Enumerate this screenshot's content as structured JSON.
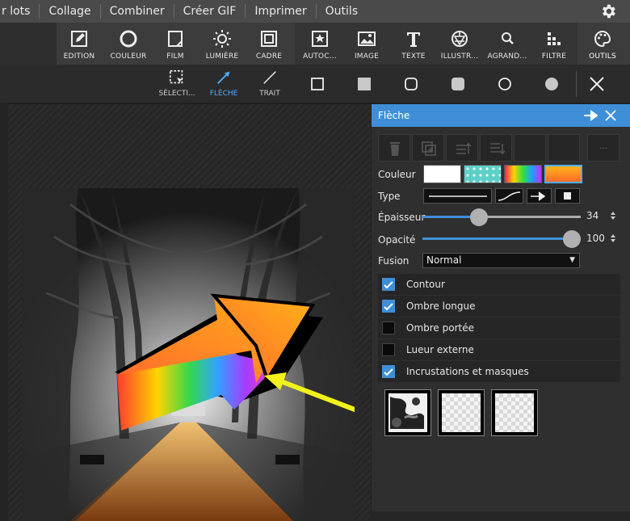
{
  "menu": [
    "r lots",
    "Collage",
    "Combiner",
    "Créer GIF",
    "Imprimer",
    "Outils"
  ],
  "toolbar": [
    {
      "label": "EDITION",
      "icon": "edit-icon"
    },
    {
      "label": "COULEUR",
      "icon": "color-icon"
    },
    {
      "label": "FILM",
      "icon": "film-icon"
    },
    {
      "label": "LUMIÈRE",
      "icon": "light-icon"
    },
    {
      "label": "CADRE",
      "icon": "frame-icon"
    },
    {
      "label": "AUTOC...",
      "icon": "sticker-icon"
    },
    {
      "label": "IMAGE",
      "icon": "image-icon"
    },
    {
      "label": "TEXTE",
      "icon": "text-icon"
    },
    {
      "label": "ILLUSTR...",
      "icon": "illustration-icon"
    },
    {
      "label": "AGRAND...",
      "icon": "zoom-icon"
    },
    {
      "label": "FILTRE",
      "icon": "filter-icon"
    },
    {
      "label": "OUTILS",
      "icon": "palette-icon"
    }
  ],
  "subtools": [
    {
      "label": "SÉLECTI...",
      "icon": "selection-icon"
    },
    {
      "label": "FLÈCHE",
      "icon": "arrow-icon"
    },
    {
      "label": "TRAIT",
      "icon": "line-icon"
    }
  ],
  "panel": {
    "title": "Flèche",
    "labels": {
      "color": "Couleur",
      "type": "Type",
      "thickness": "Épaisseur",
      "opacity": "Opacité",
      "blend": "Fusion"
    },
    "more": "...",
    "thickness_value": "34",
    "opacity_value": "100",
    "thickness_fraction": 0.34,
    "opacity_fraction": 1.0,
    "blend_mode": "Normal",
    "options": [
      {
        "label": "Contour",
        "checked": true
      },
      {
        "label": "Ombre longue",
        "checked": true
      },
      {
        "label": "Ombre portée",
        "checked": false
      },
      {
        "label": "Lueur externe",
        "checked": false
      },
      {
        "label": "Incrustations et masques",
        "checked": true
      }
    ]
  },
  "colors": {
    "accent": "#3e8fd8",
    "arrow_orange": "#ff9a1a",
    "annotation_arrow": "#f2f21a"
  }
}
